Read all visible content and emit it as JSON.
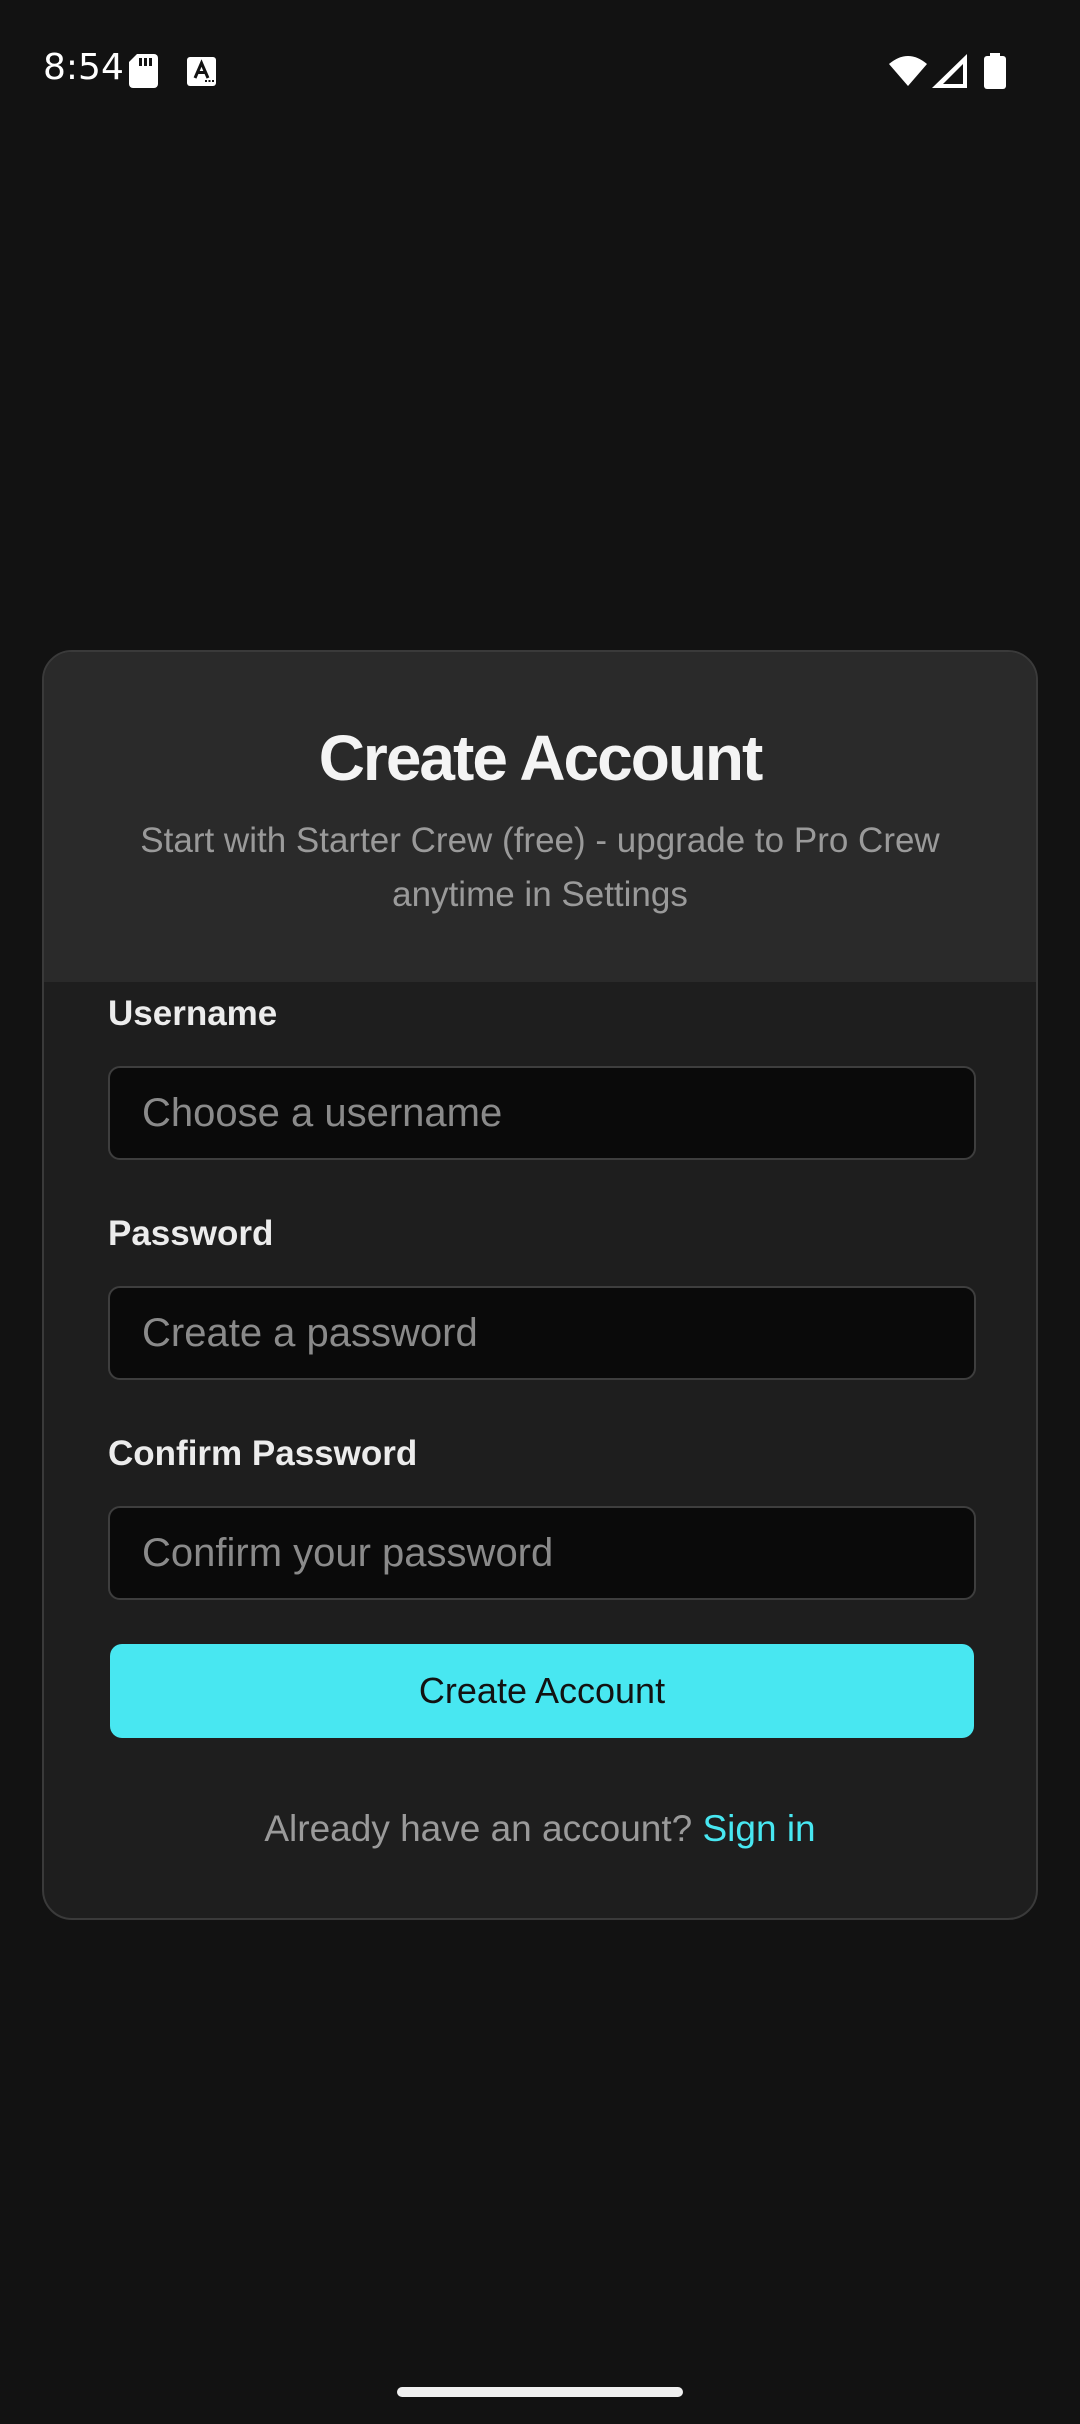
{
  "status_bar": {
    "time": "8:54",
    "icons": [
      "sd-card-icon",
      "keyboard-a-icon",
      "wifi-icon",
      "signal-icon",
      "battery-icon"
    ]
  },
  "card": {
    "title": "Create Account",
    "subtitle": "Start with Starter Crew (free) - upgrade to Pro Crew anytime in Settings"
  },
  "form": {
    "username_label": "Username",
    "username_placeholder": "Choose a username",
    "password_label": "Password",
    "password_placeholder": "Create a password",
    "confirm_label": "Confirm Password",
    "confirm_placeholder": "Confirm your password",
    "submit_label": "Create Account"
  },
  "footer": {
    "prompt": "Already have an account?",
    "signin_label": "Sign in"
  },
  "colors": {
    "background": "#121212",
    "card": "#1e1e1e",
    "card_header": "#2a2a2a",
    "accent": "#48e7f1"
  }
}
